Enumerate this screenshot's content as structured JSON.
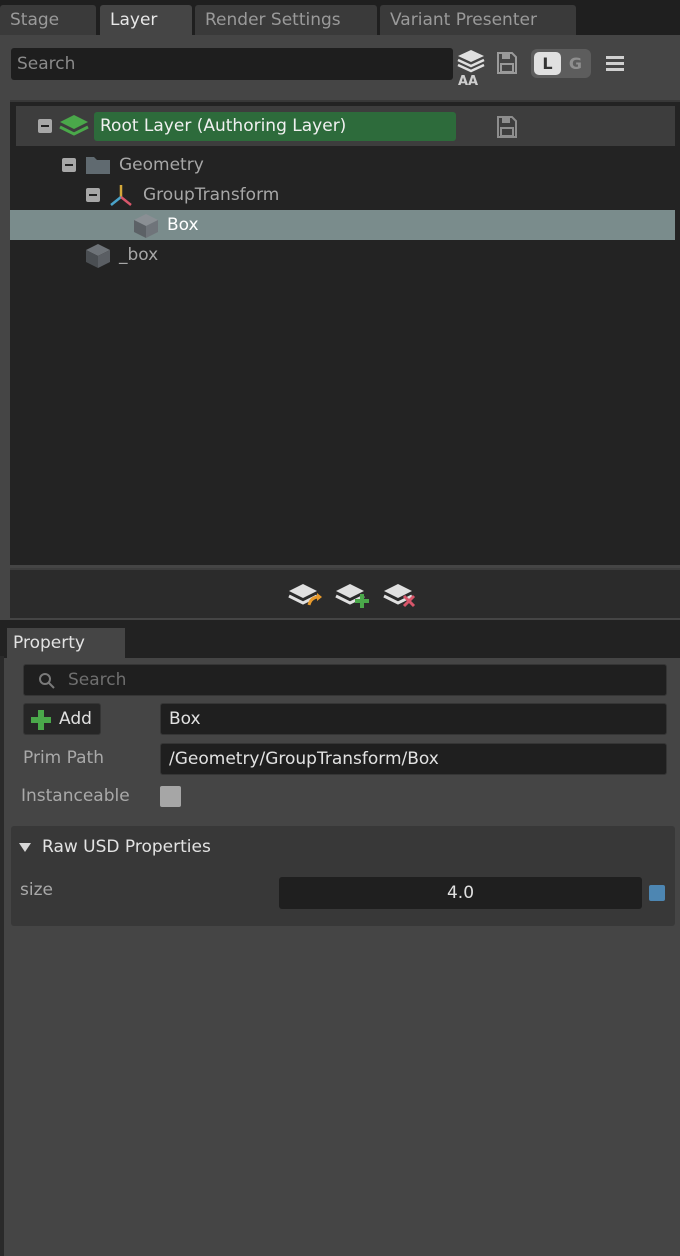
{
  "tabs": [
    {
      "label": "Stage",
      "active": false
    },
    {
      "label": "Layer",
      "active": true
    },
    {
      "label": "Render Settings",
      "active": false
    },
    {
      "label": "Variant Presenter",
      "active": false
    }
  ],
  "layer_toolbar": {
    "search_placeholder": "Search",
    "aa_label": "AA",
    "toggle_l": "L",
    "toggle_g": "G"
  },
  "tree": {
    "root_label": "Root Layer (Authoring Layer)",
    "items": [
      {
        "label": "Geometry"
      },
      {
        "label": "GroupTransform"
      },
      {
        "label": "Box"
      },
      {
        "label": "_box"
      }
    ]
  },
  "property": {
    "tab_label": "Property",
    "search_placeholder": "Search",
    "add_label": "Add",
    "name_value": "Box",
    "prim_path_label": "Prim Path",
    "prim_path_value": "/Geometry/GroupTransform/Box",
    "instanceable_label": "Instanceable",
    "instanceable_checked": false,
    "raw_section_label": "Raw USD Properties",
    "size_label": "size",
    "size_value": "4.0"
  },
  "colors": {
    "accent_green": "#2d6b3b",
    "selection": "#7a8c8c",
    "keyframe_blue": "#4d86b2"
  }
}
